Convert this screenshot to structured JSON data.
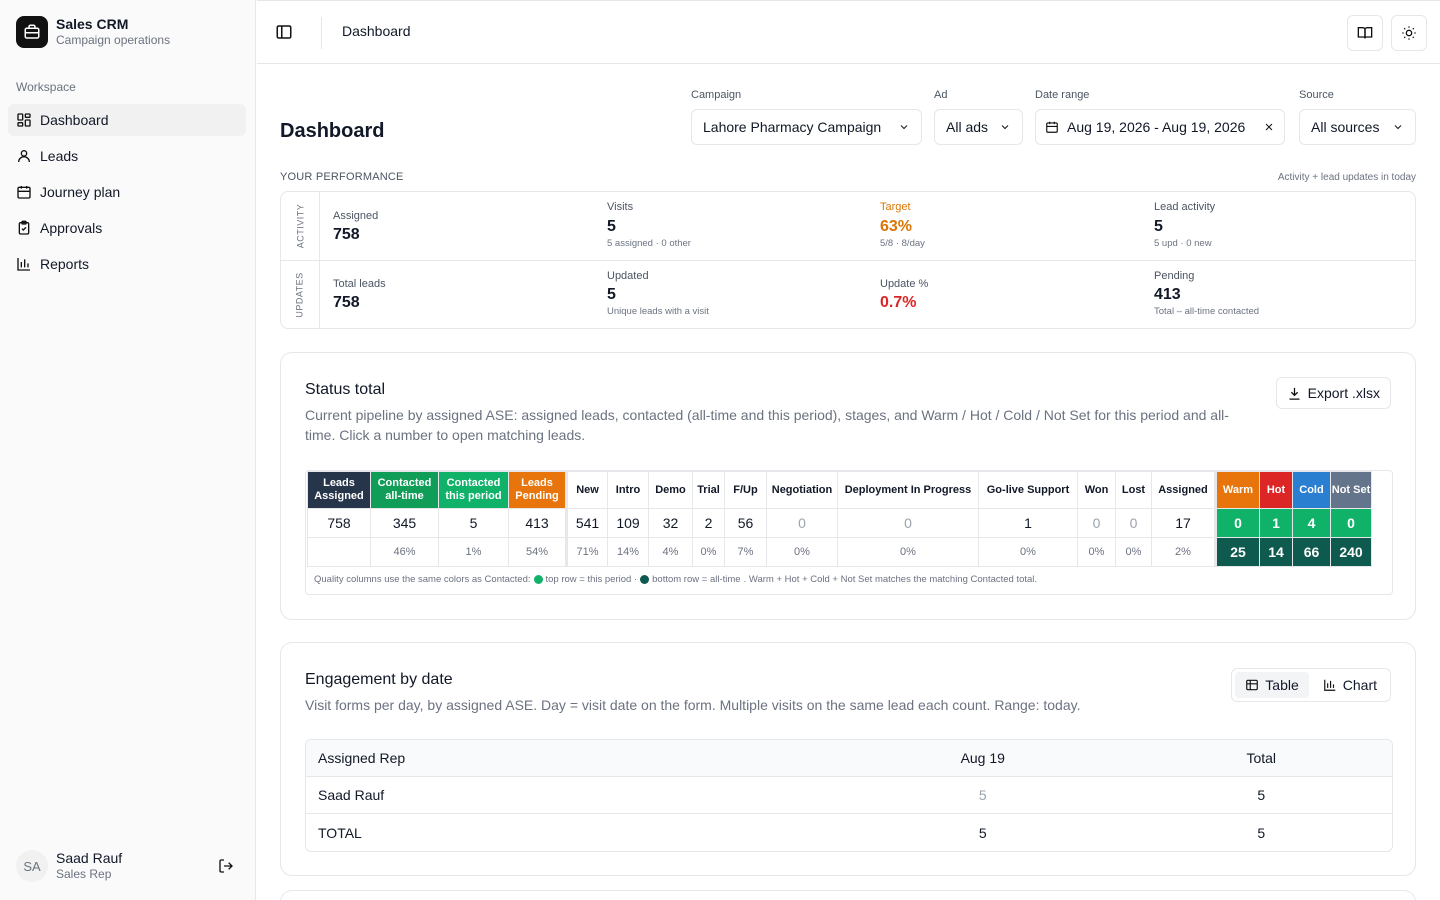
{
  "brand": {
    "title": "Sales CRM",
    "subtitle": "Campaign operations"
  },
  "sidebar": {
    "section_label": "Workspace",
    "items": [
      {
        "label": "Dashboard",
        "icon": "dashboard-icon"
      },
      {
        "label": "Leads",
        "icon": "user-icon"
      },
      {
        "label": "Journey plan",
        "icon": "calendar-icon"
      },
      {
        "label": "Approvals",
        "icon": "clipboard-check-icon"
      },
      {
        "label": "Reports",
        "icon": "bar-chart-icon"
      }
    ]
  },
  "user": {
    "initials": "SA",
    "name": "Saad Rauf",
    "role": "Sales Rep"
  },
  "topbar": {
    "breadcrumb": "Dashboard"
  },
  "page": {
    "title": "Dashboard"
  },
  "filters": {
    "campaign": {
      "label": "Campaign",
      "value": "Lahore Pharmacy Campaign"
    },
    "ad": {
      "label": "Ad",
      "value": "All ads"
    },
    "date_range": {
      "label": "Date range",
      "value": "Aug 19, 2026 - Aug 19, 2026"
    },
    "source": {
      "label": "Source",
      "value": "All sources"
    }
  },
  "performance": {
    "label": "YOUR PERFORMANCE",
    "note": "Activity + lead updates in today",
    "activity_label": "ACTIVITY",
    "updates_label": "UPDATES",
    "activity": {
      "assigned": {
        "label": "Assigned",
        "value": "758"
      },
      "visits": {
        "label": "Visits",
        "value": "5",
        "sub": "5 assigned · 0 other"
      },
      "target": {
        "label": "Target",
        "value": "63%",
        "sub": "5/8 · 8/day"
      },
      "lead_activity": {
        "label": "Lead activity",
        "value": "5",
        "sub": "5 upd · 0 new"
      }
    },
    "updates": {
      "total_leads": {
        "label": "Total leads",
        "value": "758"
      },
      "updated": {
        "label": "Updated",
        "value": "5",
        "sub": "Unique leads with a visit"
      },
      "update_pct": {
        "label": "Update %",
        "value": "0.7%"
      },
      "pending": {
        "label": "Pending",
        "value": "413",
        "sub": "Total – all-time contacted"
      }
    }
  },
  "status_total": {
    "title": "Status total",
    "description": "Current pipeline by assigned ASE: assigned leads, contacted (all-time and this period), stages, and Warm / Hot / Cold / Not Set for this period and all-time. Click a number to open matching leads.",
    "export_label": "Export .xlsx",
    "summary_headers": [
      "Leads Assigned",
      "Contacted all-time",
      "Contacted this period",
      "Leads Pending"
    ],
    "summary_values": [
      "758",
      "345",
      "5",
      "413"
    ],
    "summary_pcts": [
      "",
      "46%",
      "1%",
      "54%"
    ],
    "stage_headers": [
      "New",
      "Intro",
      "Demo",
      "Trial",
      "F/Up",
      "Negotiation",
      "Deployment In Progress",
      "Go-live Support",
      "Won",
      "Lost",
      "Assigned"
    ],
    "stage_values": [
      "541",
      "109",
      "32",
      "2",
      "56",
      "0",
      "0",
      "1",
      "0",
      "0",
      "17"
    ],
    "stage_pcts": [
      "71%",
      "14%",
      "4%",
      "0%",
      "7%",
      "0%",
      "0%",
      "0%",
      "0%",
      "0%",
      "2%"
    ],
    "quality_headers": [
      "Warm",
      "Hot",
      "Cold",
      "Not Set"
    ],
    "quality_period": [
      "0",
      "1",
      "4",
      "0"
    ],
    "quality_alltime": [
      "25",
      "14",
      "66",
      "240"
    ],
    "footnote_prefix": "Quality columns use the same colors as Contacted:",
    "footnote_top": "top row = this period ·",
    "footnote_bottom": "bottom row = all-time",
    "footnote_suffix": ". Warm + Hot + Cold + Not Set matches the matching Contacted total."
  },
  "engagement": {
    "title": "Engagement by date",
    "description": "Visit forms per day, by assigned ASE. Day = visit date on the form. Multiple visits on the same lead each count. Range: today.",
    "toggle": {
      "table": "Table",
      "chart": "Chart"
    },
    "columns": [
      "Assigned Rep",
      "Aug 19",
      "Total"
    ],
    "rows": [
      {
        "rep": "Saad Rauf",
        "day": "5",
        "total": "5"
      },
      {
        "rep": "TOTAL",
        "day": "5",
        "total": "5"
      }
    ]
  },
  "colors": {
    "navy": "#27354a",
    "green": "#0f9d58",
    "orange": "#e8750c",
    "red": "#dc2626",
    "blue": "#2b7fd1",
    "slate": "#64748b",
    "teal_light": "#10b26a",
    "teal_dark": "#0f5a4f",
    "target_amber": "#d97706",
    "danger": "#dc2626"
  }
}
